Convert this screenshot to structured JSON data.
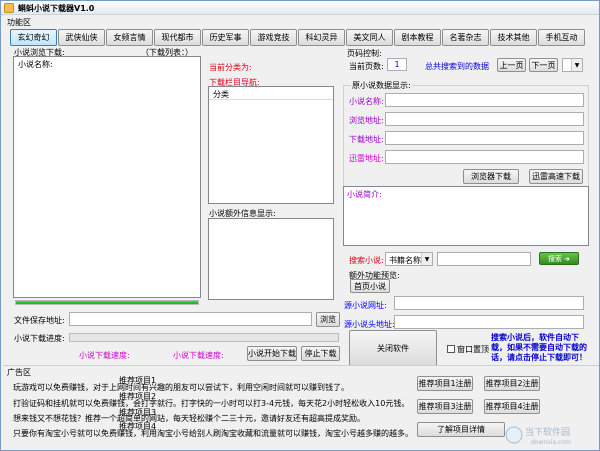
{
  "window": {
    "title": "蝌蚪小说下载器V1.0"
  },
  "function_area": {
    "label": "功能区",
    "tabs": [
      "玄幻奇幻",
      "武侠仙侠",
      "女频言情",
      "现代都市",
      "历史军事",
      "游戏竞技",
      "科幻灵异",
      "美文同人",
      "剧本教程",
      "名著杂志",
      "技术其他",
      "手机互动"
    ],
    "active_tab": 0
  },
  "left_panel": {
    "browse_label": "小说浏览下载:",
    "list_header_hint": "（下载列表：）",
    "name_col": "小说名称:",
    "progress_fraction": 1.0,
    "save_path_label": "文件保存地址:",
    "browse_button": "浏览",
    "download_progress_label": "小说下载进度:",
    "status_speed_left": "小说下载速度:",
    "status_speed_mid": "小说下载速度:",
    "start_button": "小说开始下载",
    "stop_button": "停止下载"
  },
  "middle_panel": {
    "current_category_label": "当前分类为:",
    "nav_label": "下载栏目导航:",
    "category_col": "分类",
    "extra_info_label": "小说额外信息显示:"
  },
  "right_panel": {
    "page_control_label": "页码控制:",
    "current_page_label": "当前页数:",
    "current_page_value": "1",
    "total_pages_text": "总共搜索到的数据",
    "prev_button": "上一页",
    "next_button": "下一页",
    "raw_data_label": "原小说数据显示:",
    "name_label": "小说名称:",
    "browse_url_label": "浏览地址:",
    "download_url_label": "下载地址:",
    "thunder_url_label": "迅雷地址:",
    "browser_download_button": "浏览器下载",
    "thunder_download_button": "迅雷高速下载",
    "intro_label": "小说简介:",
    "search_label": "搜索小说:",
    "search_type_value": "书籍名称",
    "search_go_button": "搜索 ➜",
    "extra_function_label": "额外功能预览:",
    "homepage_button": "首页小说",
    "source_url_label": "源小说网址:",
    "source_header_label": "源小说头地址:",
    "close_button": "关闭软件",
    "window_top_label": "窗口置顶",
    "search_hint": "搜索小说后，软件自动下载，如果不需要自动下载的话，请点击停止下载即可！"
  },
  "ad_area": {
    "label": "广告区",
    "lines": [
      "玩游戏可以免费赚钱，对于上网时间有兴趣的朋友可以尝试下，利用空闲时间就可以赚到钱了。",
      "打验证码和挂机就可以免费赚钱，会打字就行。打字快的一小时可以打3-4元钱，每天花2小时轻松收入10元钱。",
      "想来钱又不想花钱？推荐一个超简单的网站，每天轻松赚个二三十元，邀请好友还有超高提成奖励。",
      "只要你有淘宝小号就可以免费赚钱，利用淘宝小号给别人刷淘宝收藏和流量就可以赚钱，淘宝小号越多赚的越多。"
    ],
    "ghost_labels": [
      "推荐项目1",
      "推荐项目2",
      "推荐项目3",
      "推荐项目4"
    ],
    "buttons": [
      "推荐项目1注册",
      "推荐项目2注册",
      "推荐项目3注册",
      "推荐项目4注册"
    ],
    "more_button": "了解项目详情"
  },
  "watermark": {
    "text": "当下软件园",
    "sub": "downxia.com"
  }
}
